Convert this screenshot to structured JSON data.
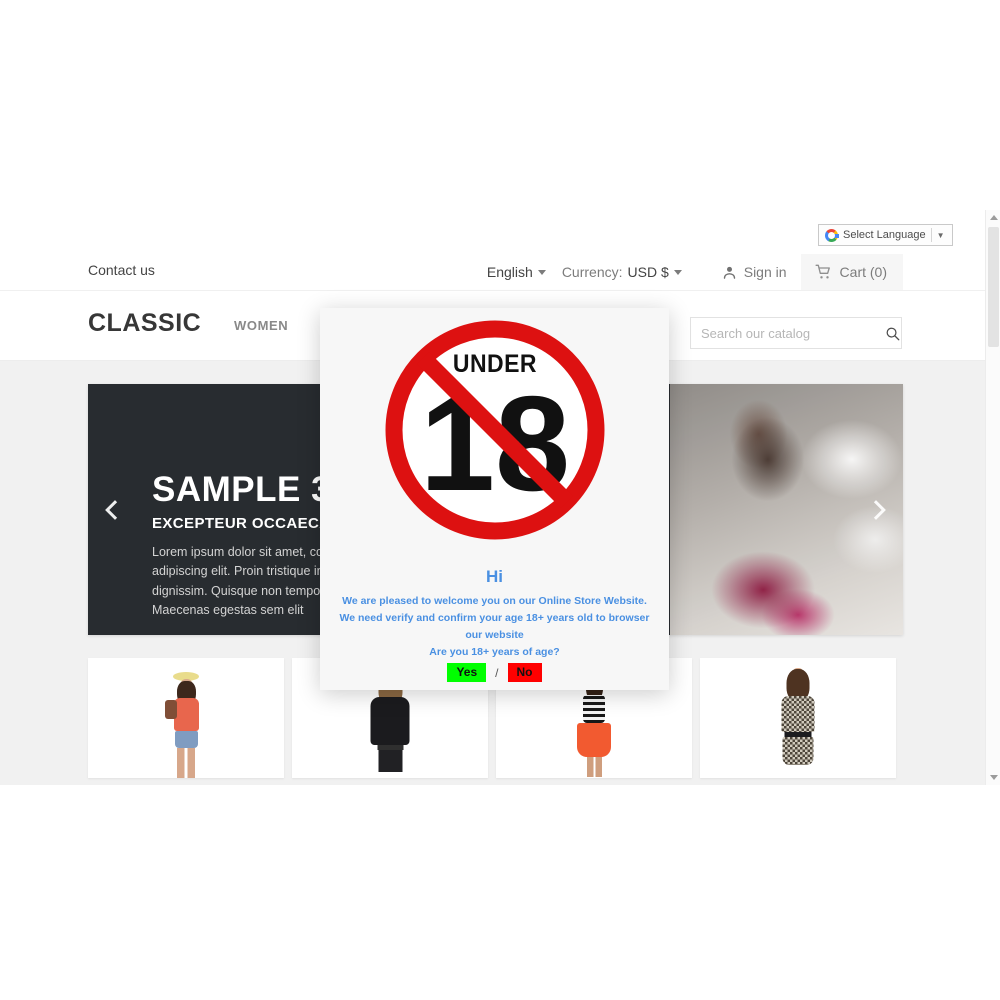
{
  "topbar": {
    "translate_widget": {
      "icon": "google-g-icon",
      "label": "Select Language",
      "caret": "▼"
    },
    "contact_label": "Contact us",
    "language": "English",
    "currency_label": "Currency:",
    "currency_value": "USD $",
    "signin_label": "Sign in",
    "signin_icon": "user-icon",
    "cart_label": "Cart (0)",
    "cart_icon": "shopping-cart-icon"
  },
  "header": {
    "logo": "CLASSIC",
    "nav": [
      {
        "label": "WOMEN"
      }
    ],
    "search": {
      "placeholder": "Search our catalog",
      "value": "",
      "icon": "search-icon"
    }
  },
  "carousel": {
    "title": "SAMPLE 3",
    "subtitle": "EXCEPTEUR OCCAECAT",
    "body": "Lorem ipsum dolor sit amet, consectetur adipiscing elit. Proin tristique in tortor et dignissim. Quisque non tempor leo. Maecenas egestas sem elit",
    "prev_icon": "chevron-left-icon",
    "next_icon": "chevron-right-icon"
  },
  "products": [
    {
      "name": "product-card-1"
    },
    {
      "name": "product-card-2"
    },
    {
      "name": "product-card-3"
    },
    {
      "name": "product-card-4"
    }
  ],
  "modal": {
    "sign": {
      "top_text": "UNDER",
      "age_text": "18",
      "icon": "no-under-18-icon",
      "circle_color": "#dd1111"
    },
    "greeting": "Hi",
    "line1": "We are pleased to welcome you on our  Online Store Website.",
    "line2": "We need verify and confirm your age 18+ years old to browser our website",
    "line3": "Are you 18+ years of age?",
    "yes_label": "Yes",
    "separator": "/",
    "no_label": "No",
    "yes_color": "#00ff00",
    "no_color": "#ff0000",
    "text_color": "#4a90e2"
  },
  "scrollbar": {
    "up_icon": "scroll-up-arrow-icon",
    "down_icon": "scroll-down-arrow-icon"
  }
}
